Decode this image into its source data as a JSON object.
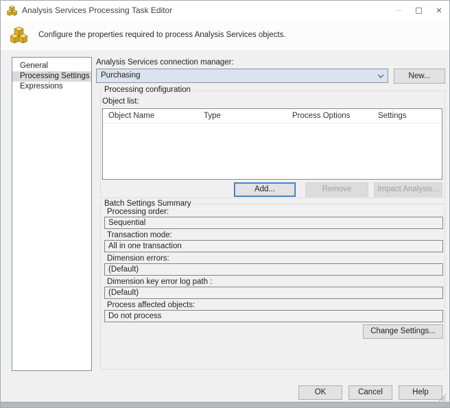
{
  "window": {
    "title": "Analysis Services Processing Task Editor",
    "controls": {
      "minimize": "",
      "maximize": "",
      "close": "✕"
    }
  },
  "header": {
    "description": "Configure the properties required to process Analysis Services objects."
  },
  "sidebar": {
    "items": [
      {
        "label": "General",
        "selected": false
      },
      {
        "label": "Processing Settings",
        "selected": true
      },
      {
        "label": "Expressions",
        "selected": false
      }
    ]
  },
  "connection": {
    "label": "Analysis Services connection manager:",
    "value": "Purchasing",
    "new_button": "New..."
  },
  "processing_configuration": {
    "group_label": "Processing configuration",
    "object_list_label": "Object list:",
    "table": {
      "columns": [
        "Object Name",
        "Type",
        "Process Options",
        "Settings"
      ],
      "rows": []
    },
    "buttons": {
      "add": "Add...",
      "remove": "Remove",
      "impact": "Impact Analysis..."
    }
  },
  "batch_settings": {
    "group_label": "Batch Settings Summary",
    "fields": [
      {
        "label": "Processing order:",
        "value": "Sequential"
      },
      {
        "label": "Transaction mode:",
        "value": "All in one transaction"
      },
      {
        "label": "Dimension errors:",
        "value": "(Default)"
      },
      {
        "label": "Dimension key error log path :",
        "value": "(Default)"
      },
      {
        "label": "Process affected objects:",
        "value": "Do not process"
      }
    ],
    "change_settings_button": "Change Settings..."
  },
  "footer": {
    "ok": "OK",
    "cancel": "Cancel",
    "help": "Help"
  },
  "colors": {
    "dialog_bg": "#f0f0f0",
    "titlebar_bg": "#ffffff",
    "focus_accent": "#2d7dd2",
    "sidebar_selection": "#d9d9d9",
    "combo_fill": "#dce3ee",
    "icon_gold": "#e9b62a",
    "bottom_strip": "#b6b9bc"
  }
}
